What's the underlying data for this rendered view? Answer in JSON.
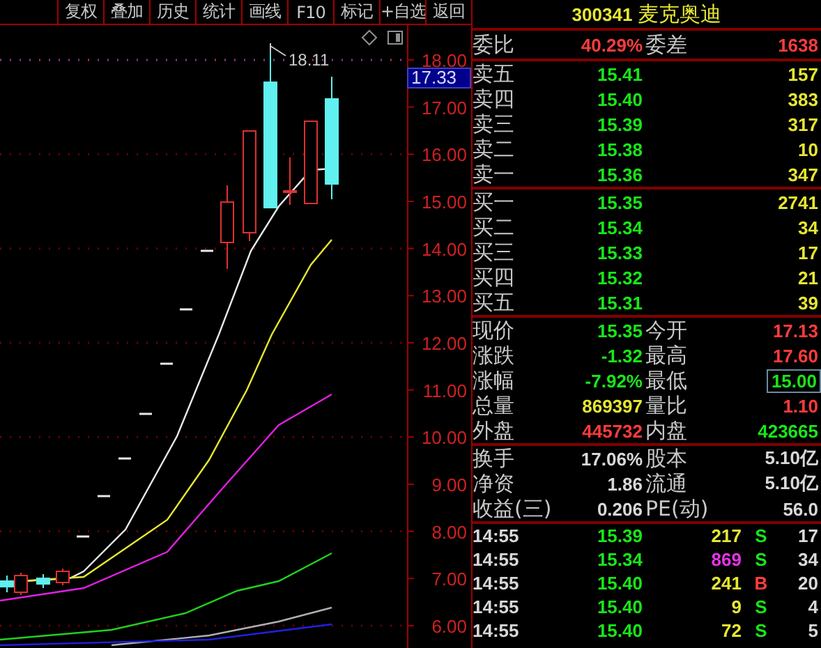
{
  "toolbar": [
    "复权",
    "叠加",
    "历史",
    "统计",
    "画线",
    "F10",
    "标记",
    "+自选",
    "返回"
  ],
  "chart": {
    "axis_labels": [
      "18.00",
      "17.00",
      "16.00",
      "15.00",
      "14.00",
      "13.00",
      "12.00",
      "11.00",
      "10.00",
      "9.00",
      "8.00",
      "7.00",
      "6.00"
    ],
    "high_label": "18.11",
    "current_price": "17.33"
  },
  "quote": {
    "code": "300341",
    "name": "麦克奥迪",
    "ratio": [
      {
        "label": "委比",
        "value": "40.29%"
      },
      {
        "label": "委差",
        "value": "1638"
      }
    ],
    "asks": [
      {
        "label": "卖五",
        "price": "15.41",
        "volume": "157"
      },
      {
        "label": "卖四",
        "price": "15.40",
        "volume": "383"
      },
      {
        "label": "卖三",
        "price": "15.39",
        "volume": "317"
      },
      {
        "label": "卖二",
        "price": "15.38",
        "volume": "10"
      },
      {
        "label": "卖一",
        "price": "15.36",
        "volume": "347"
      }
    ],
    "bids": [
      {
        "label": "买一",
        "price": "15.35",
        "volume": "2741"
      },
      {
        "label": "买二",
        "price": "15.34",
        "volume": "34"
      },
      {
        "label": "买三",
        "price": "15.33",
        "volume": "17"
      },
      {
        "label": "买四",
        "price": "15.32",
        "volume": "21"
      },
      {
        "label": "买五",
        "price": "15.31",
        "volume": "39"
      }
    ],
    "stats": [
      [
        {
          "label": "现价",
          "value": "15.35",
          "color": "#18e618",
          "highlighted": false
        },
        {
          "label": "今开",
          "value": "17.13",
          "color": "#ff3c3c",
          "highlighted": false
        }
      ],
      [
        {
          "label": "涨跌",
          "value": "-1.32",
          "color": "#18e618",
          "highlighted": false
        },
        {
          "label": "最高",
          "value": "17.60",
          "color": "#ff3c3c",
          "highlighted": false
        }
      ],
      [
        {
          "label": "涨幅",
          "value": "-7.92%",
          "color": "#18e618",
          "highlighted": false
        },
        {
          "label": "最低",
          "value": "15.00",
          "color": "#18e618",
          "highlighted": true
        }
      ],
      [
        {
          "label": "总量",
          "value": "869397",
          "color": "#e6e632",
          "highlighted": false
        },
        {
          "label": "量比",
          "value": "1.10",
          "color": "#ff3c3c",
          "highlighted": false
        }
      ],
      [
        {
          "label": "外盘",
          "value": "445732",
          "color": "#ff3c3c",
          "highlighted": false
        },
        {
          "label": "内盘",
          "value": "423665",
          "color": "#18e618",
          "highlighted": false
        }
      ]
    ],
    "fundamentals": [
      [
        {
          "label": "换手",
          "value": "17.06%"
        },
        {
          "label": "股本",
          "value": "5.10亿"
        }
      ],
      [
        {
          "label": "净资",
          "value": "1.86"
        },
        {
          "label": "流通",
          "value": "5.10亿"
        }
      ],
      [
        {
          "label": "收益(三)",
          "value": "0.206"
        },
        {
          "label": "PE(动)",
          "value": "56.0"
        }
      ]
    ],
    "ticks": [
      {
        "time": "14:55",
        "price": "15.39",
        "volume": {
          "text": "217",
          "color": "#e6e632"
        },
        "side": {
          "text": "S",
          "color": "#18e618"
        },
        "count": "17"
      },
      {
        "time": "14:55",
        "price": "15.34",
        "volume": {
          "text": "869",
          "color": "#e632e6"
        },
        "side": {
          "text": "S",
          "color": "#18e618"
        },
        "count": "34"
      },
      {
        "time": "14:55",
        "price": "15.40",
        "volume": {
          "text": "241",
          "color": "#e6e632"
        },
        "side": {
          "text": "B",
          "color": "#ff3c3c"
        },
        "count": "20"
      },
      {
        "time": "14:55",
        "price": "15.40",
        "volume": {
          "text": "9",
          "color": "#e6e632"
        },
        "side": {
          "text": "S",
          "color": "#18e618"
        },
        "count": "4"
      },
      {
        "time": "14:55",
        "price": "15.40",
        "volume": {
          "text": "72",
          "color": "#e6e632"
        },
        "side": {
          "text": "S",
          "color": "#18e618"
        },
        "count": "5"
      }
    ]
  }
}
